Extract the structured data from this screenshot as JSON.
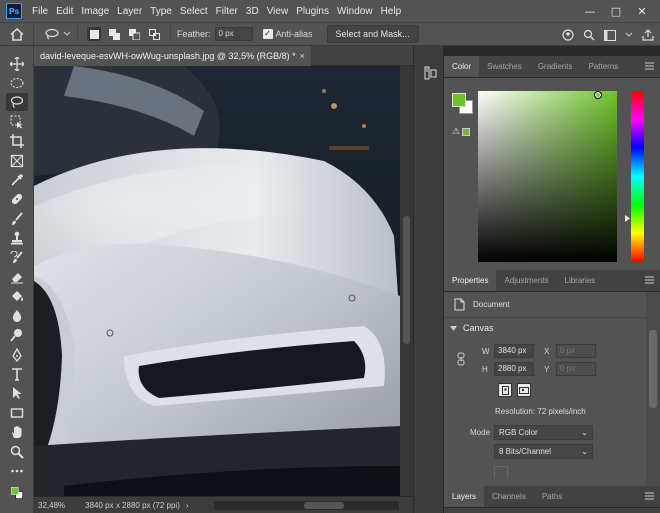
{
  "app": {
    "logo_text": "Ps"
  },
  "menu": [
    "File",
    "Edit",
    "Image",
    "Layer",
    "Type",
    "Select",
    "Filter",
    "3D",
    "View",
    "Plugins",
    "Window",
    "Help"
  ],
  "window_controls": {
    "minimize": "—",
    "maximize": "□",
    "close": "✕"
  },
  "options_bar": {
    "feather_label": "Feather:",
    "feather_value": "0 px",
    "antialias_label": "Anti-alias",
    "antialias_checked": "✓",
    "select_mask_label": "Select and Mask..."
  },
  "document": {
    "tab_title": "david-leveque-esvWH-owWug-unsplash.jpg @ 32,5% (RGB/8) *",
    "close_glyph": "×",
    "zoom": "32,48%",
    "info": "3840 px x 2880 px (72 ppi)",
    "info_arrow": "›"
  },
  "color_panel": {
    "tabs": [
      "Color",
      "Swatches",
      "Gradients",
      "Patterns"
    ],
    "active_tab": "Color",
    "foreground": "#6ec42a",
    "background": "#ffffff",
    "gamut_warning": "⚠"
  },
  "properties_panel": {
    "tabs": [
      "Properties",
      "Adjustments",
      "Libraries"
    ],
    "active_tab": "Properties",
    "document_label": "Document",
    "canvas_section": "Canvas",
    "w_label": "W",
    "w_value": "3840 px",
    "h_label": "H",
    "h_value": "2880 px",
    "x_label": "X",
    "x_value": "0 px",
    "y_label": "Y",
    "y_value": "0 px",
    "resolution": "Resolution: 72 pixels/inch",
    "mode_label": "Mode",
    "mode_value": "RGB Color",
    "depth_value": "8 Bits/Channel",
    "dd_arrow": "⌄"
  },
  "layers_panel": {
    "tabs": [
      "Layers",
      "Channels",
      "Paths"
    ],
    "active_tab": "Layers"
  }
}
